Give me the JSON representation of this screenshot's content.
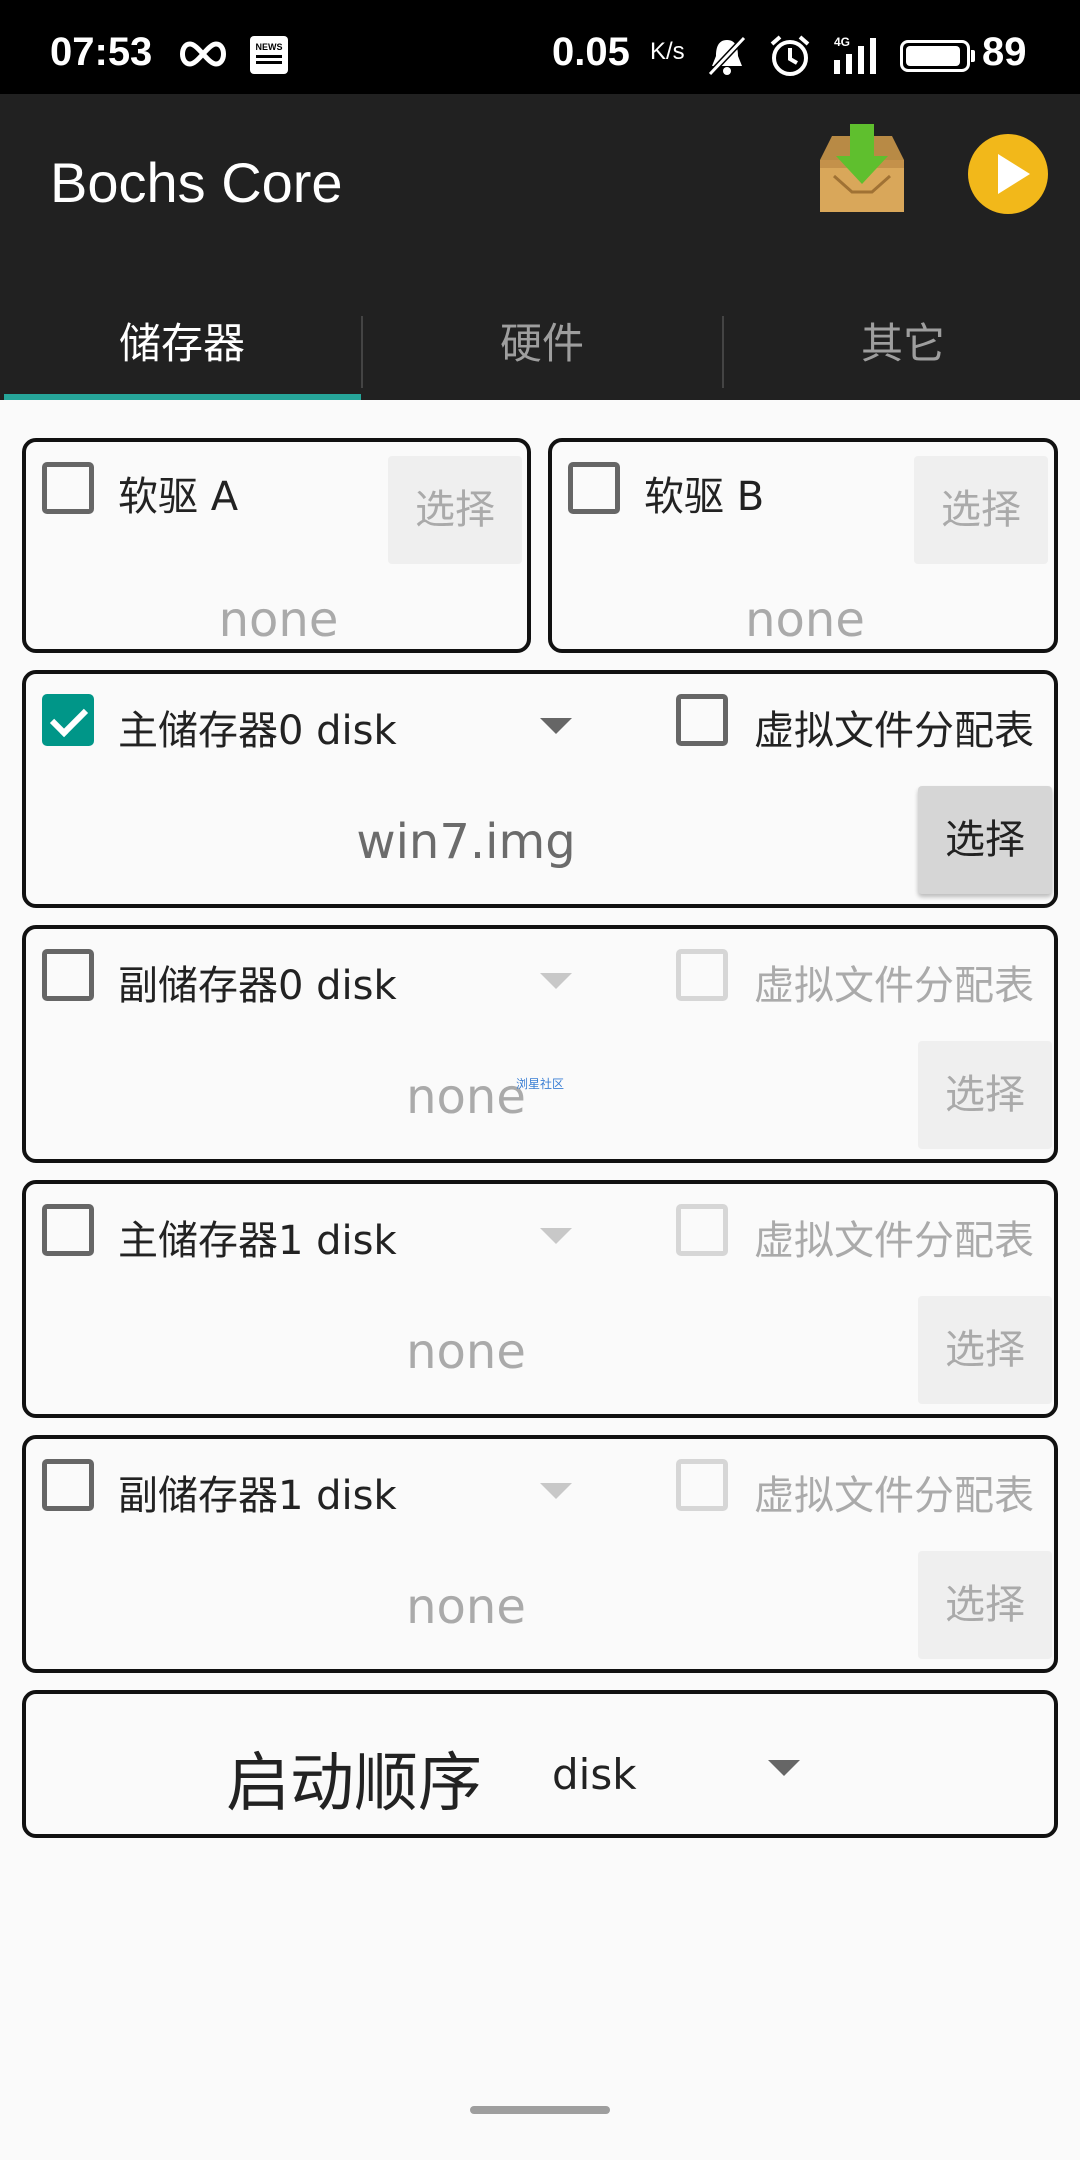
{
  "status_bar": {
    "time": "07:53",
    "news_icon_text": "NEWS",
    "speed": "0.05",
    "speed_unit": "K/s",
    "battery": "89",
    "icons": [
      "infinity-icon",
      "news-icon",
      "bell-muted-icon",
      "alarm-icon",
      "signal-4g-icon",
      "battery-icon"
    ]
  },
  "app_bar": {
    "title": "Bochs Core",
    "download_icon": "download-box-icon",
    "play_icon": "play-icon",
    "accent": "#26a69a",
    "play_color": "#f2b81a"
  },
  "tabs": [
    {
      "label": "储存器",
      "active": true
    },
    {
      "label": "硬件",
      "active": false
    },
    {
      "label": "其它",
      "active": false
    }
  ],
  "floppy": {
    "a": {
      "label": "软驱 A",
      "checked": false,
      "file": "none",
      "select": "选择"
    },
    "b": {
      "label": "软驱 B",
      "checked": false,
      "file": "none",
      "select": "选择"
    }
  },
  "drives": [
    {
      "label": "主储存器0 disk",
      "checked": true,
      "vfat_label": "虚拟文件分配表",
      "vfat_checked": false,
      "file": "win7.img",
      "select": "选择"
    },
    {
      "label": "副储存器0 disk",
      "checked": false,
      "vfat_label": "虚拟文件分配表",
      "vfat_checked": false,
      "file": "none",
      "select": "选择"
    },
    {
      "label": "主储存器1 disk",
      "checked": false,
      "vfat_label": "虚拟文件分配表",
      "vfat_checked": false,
      "file": "none",
      "select": "选择"
    },
    {
      "label": "副储存器1 disk",
      "checked": false,
      "vfat_label": "虚拟文件分配表",
      "vfat_checked": false,
      "file": "none",
      "select": "选择"
    }
  ],
  "watermark": "浏星社区",
  "boot": {
    "label": "启动顺序",
    "value": "disk"
  }
}
